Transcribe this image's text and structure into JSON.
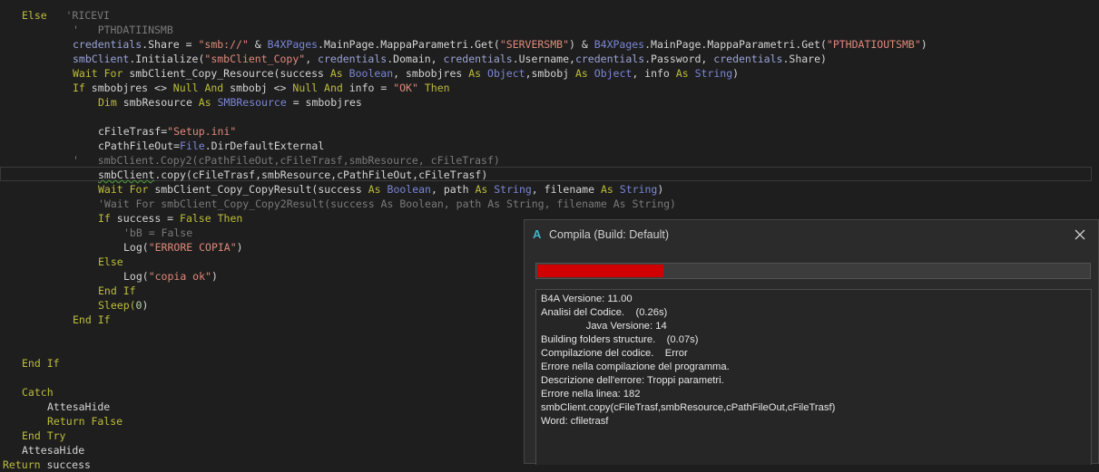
{
  "editor": {
    "lines": [
      {
        "indent": 3,
        "tokens": [
          {
            "t": "Else",
            "c": "kw"
          },
          {
            "t": "   'RICEVI",
            "c": "cm"
          }
        ]
      },
      {
        "indent": 11,
        "tokens": [
          {
            "t": "'   PTHDATIINSMB",
            "c": "cm"
          }
        ]
      },
      {
        "indent": 11,
        "tokens": [
          {
            "t": "credentials",
            "c": "var"
          },
          {
            "t": ".Share = ",
            "c": "tx"
          },
          {
            "t": "\"smb://\"",
            "c": "str"
          },
          {
            "t": " & ",
            "c": "tx"
          },
          {
            "t": "B4XPages",
            "c": "ty"
          },
          {
            "t": ".MainPage.MappaParametri.Get(",
            "c": "tx"
          },
          {
            "t": "\"SERVERSMB\"",
            "c": "str"
          },
          {
            "t": ") & ",
            "c": "tx"
          },
          {
            "t": "B4XPages",
            "c": "ty"
          },
          {
            "t": ".MainPage.MappaParametri.Get(",
            "c": "tx"
          },
          {
            "t": "\"PTHDATIOUTSMB\"",
            "c": "str"
          },
          {
            "t": ")",
            "c": "tx"
          }
        ]
      },
      {
        "indent": 11,
        "tokens": [
          {
            "t": "smbClient",
            "c": "var"
          },
          {
            "t": ".Initialize(",
            "c": "tx"
          },
          {
            "t": "\"smbClient_Copy\"",
            "c": "str"
          },
          {
            "t": ", ",
            "c": "tx"
          },
          {
            "t": "credentials",
            "c": "var"
          },
          {
            "t": ".Domain, ",
            "c": "tx"
          },
          {
            "t": "credentials",
            "c": "var"
          },
          {
            "t": ".Username,",
            "c": "tx"
          },
          {
            "t": "credentials",
            "c": "var"
          },
          {
            "t": ".Password, ",
            "c": "tx"
          },
          {
            "t": "credentials",
            "c": "var"
          },
          {
            "t": ".Share)",
            "c": "tx"
          }
        ]
      },
      {
        "indent": 11,
        "tokens": [
          {
            "t": "Wait For",
            "c": "kw"
          },
          {
            "t": " smbClient_Copy_Resource(success ",
            "c": "tx"
          },
          {
            "t": "As",
            "c": "kw"
          },
          {
            "t": " ",
            "c": "tx"
          },
          {
            "t": "Boolean",
            "c": "ty"
          },
          {
            "t": ", smbobjres ",
            "c": "tx"
          },
          {
            "t": "As",
            "c": "kw"
          },
          {
            "t": " ",
            "c": "tx"
          },
          {
            "t": "Object",
            "c": "ty"
          },
          {
            "t": ",smbobj ",
            "c": "tx"
          },
          {
            "t": "As",
            "c": "kw"
          },
          {
            "t": " ",
            "c": "tx"
          },
          {
            "t": "Object",
            "c": "ty"
          },
          {
            "t": ", info ",
            "c": "tx"
          },
          {
            "t": "As",
            "c": "kw"
          },
          {
            "t": " ",
            "c": "tx"
          },
          {
            "t": "String",
            "c": "ty"
          },
          {
            "t": ")",
            "c": "tx"
          }
        ]
      },
      {
        "indent": 11,
        "tokens": [
          {
            "t": "If",
            "c": "kw"
          },
          {
            "t": " smbobjres <> ",
            "c": "tx"
          },
          {
            "t": "Null",
            "c": "kw"
          },
          {
            "t": " ",
            "c": "tx"
          },
          {
            "t": "And",
            "c": "kw"
          },
          {
            "t": " smbobj <> ",
            "c": "tx"
          },
          {
            "t": "Null",
            "c": "kw"
          },
          {
            "t": " ",
            "c": "tx"
          },
          {
            "t": "And",
            "c": "kw"
          },
          {
            "t": " info = ",
            "c": "tx"
          },
          {
            "t": "\"OK\"",
            "c": "str"
          },
          {
            "t": " ",
            "c": "tx"
          },
          {
            "t": "Then",
            "c": "kw"
          }
        ]
      },
      {
        "indent": 15,
        "tokens": [
          {
            "t": "Dim",
            "c": "kw"
          },
          {
            "t": " smbResource ",
            "c": "tx"
          },
          {
            "t": "As",
            "c": "kw"
          },
          {
            "t": " ",
            "c": "tx"
          },
          {
            "t": "SMBResource",
            "c": "ty"
          },
          {
            "t": " = smbobjres",
            "c": "tx"
          }
        ]
      },
      {
        "indent": 0,
        "tokens": []
      },
      {
        "indent": 15,
        "tokens": [
          {
            "t": "cFileTrasf=",
            "c": "tx"
          },
          {
            "t": "\"Setup.ini\"",
            "c": "str"
          }
        ]
      },
      {
        "indent": 15,
        "tokens": [
          {
            "t": "cPathFileOut=",
            "c": "tx"
          },
          {
            "t": "File",
            "c": "ty"
          },
          {
            "t": ".DirDefaultExternal",
            "c": "tx"
          }
        ]
      },
      {
        "indent": 11,
        "tokens": [
          {
            "t": "'   smbClient.Copy2(cPathFileOut,cFileTrasf,smbResource, cFileTrasf)",
            "c": "cm"
          }
        ]
      },
      {
        "indent": 15,
        "tokens": [
          {
            "t": "smbClient",
            "c": "err"
          },
          {
            "t": ".copy(cFileTrasf,smbResource,cPathFileOut,cFileTrasf)",
            "c": "tx"
          }
        ]
      },
      {
        "indent": 15,
        "tokens": [
          {
            "t": "Wait For",
            "c": "kw"
          },
          {
            "t": " smbClient_Copy_CopyResult(success ",
            "c": "tx"
          },
          {
            "t": "As",
            "c": "kw"
          },
          {
            "t": " ",
            "c": "tx"
          },
          {
            "t": "Boolean",
            "c": "ty"
          },
          {
            "t": ", path ",
            "c": "tx"
          },
          {
            "t": "As",
            "c": "kw"
          },
          {
            "t": " ",
            "c": "tx"
          },
          {
            "t": "String",
            "c": "ty"
          },
          {
            "t": ", filename ",
            "c": "tx"
          },
          {
            "t": "As",
            "c": "kw"
          },
          {
            "t": " ",
            "c": "tx"
          },
          {
            "t": "String",
            "c": "ty"
          },
          {
            "t": ")",
            "c": "tx"
          }
        ]
      },
      {
        "indent": 15,
        "tokens": [
          {
            "t": "'Wait For smbClient_Copy_Copy2Result(success As Boolean, path As String, filename As String)",
            "c": "cm"
          }
        ]
      },
      {
        "indent": 15,
        "tokens": [
          {
            "t": "If",
            "c": "kw"
          },
          {
            "t": " success = ",
            "c": "tx"
          },
          {
            "t": "False",
            "c": "kw"
          },
          {
            "t": " ",
            "c": "tx"
          },
          {
            "t": "Then",
            "c": "kw"
          }
        ]
      },
      {
        "indent": 19,
        "tokens": [
          {
            "t": "'bB = False",
            "c": "cm"
          }
        ]
      },
      {
        "indent": 19,
        "tokens": [
          {
            "t": "Log(",
            "c": "tx"
          },
          {
            "t": "\"ERRORE COPIA\"",
            "c": "str"
          },
          {
            "t": ")",
            "c": "tx"
          }
        ]
      },
      {
        "indent": 15,
        "tokens": [
          {
            "t": "Else",
            "c": "kw"
          }
        ]
      },
      {
        "indent": 19,
        "tokens": [
          {
            "t": "Log(",
            "c": "tx"
          },
          {
            "t": "\"copia ok\"",
            "c": "str"
          },
          {
            "t": ")",
            "c": "tx"
          }
        ]
      },
      {
        "indent": 15,
        "tokens": [
          {
            "t": "End If",
            "c": "kw"
          }
        ]
      },
      {
        "indent": 15,
        "tokens": [
          {
            "t": "Sleep(",
            "c": "kw"
          },
          {
            "t": "0",
            "c": "num"
          },
          {
            "t": ")",
            "c": "tx"
          }
        ]
      },
      {
        "indent": 11,
        "tokens": [
          {
            "t": "End If",
            "c": "kw"
          }
        ]
      },
      {
        "indent": 0,
        "tokens": []
      },
      {
        "indent": 0,
        "tokens": []
      },
      {
        "indent": 3,
        "tokens": [
          {
            "t": "End If",
            "c": "kw"
          }
        ]
      },
      {
        "indent": 0,
        "tokens": []
      },
      {
        "indent": 3,
        "tokens": [
          {
            "t": "Catch",
            "c": "kw"
          }
        ]
      },
      {
        "indent": 7,
        "tokens": [
          {
            "t": "AttesaHide",
            "c": "tx"
          }
        ]
      },
      {
        "indent": 7,
        "tokens": [
          {
            "t": "Return False",
            "c": "kw"
          }
        ]
      },
      {
        "indent": 3,
        "tokens": [
          {
            "t": "End Try",
            "c": "kw"
          }
        ]
      },
      {
        "indent": 3,
        "tokens": [
          {
            "t": "AttesaHide",
            "c": "tx"
          }
        ]
      },
      {
        "indent": 0,
        "tokens": [
          {
            "t": "Return",
            "c": "kw"
          },
          {
            "t": " success",
            "c": "tx"
          }
        ]
      }
    ]
  },
  "dialog": {
    "logo": "A",
    "title": "Compila (Build: Default)",
    "close_icon": "close-icon",
    "progress": 0.23,
    "progress_color": "#d00000",
    "log_lines": [
      "B4A Versione: 11.00",
      "Analisi del Codice.    (0.26s)",
      "                Java Versione: 14",
      "Building folders structure.    (0.07s)",
      "Compilazione del codice.    Error",
      "Errore nella compilazione del programma.",
      "Descrizione dell'errore: Troppi parametri.",
      "Errore nella linea: 182",
      "smbClient.copy(cFileTrasf,smbResource,cPathFileOut,cFileTrasf)",
      "Word: cfiletrasf"
    ]
  },
  "colors": {
    "editor_bg": "#1e1e1e",
    "keyword": "#bdbd3b",
    "string": "#e0897a",
    "comment": "#7a7a7a",
    "type": "#7a86d6",
    "error_bar": "#d00000",
    "logo": "#3db3c9"
  }
}
